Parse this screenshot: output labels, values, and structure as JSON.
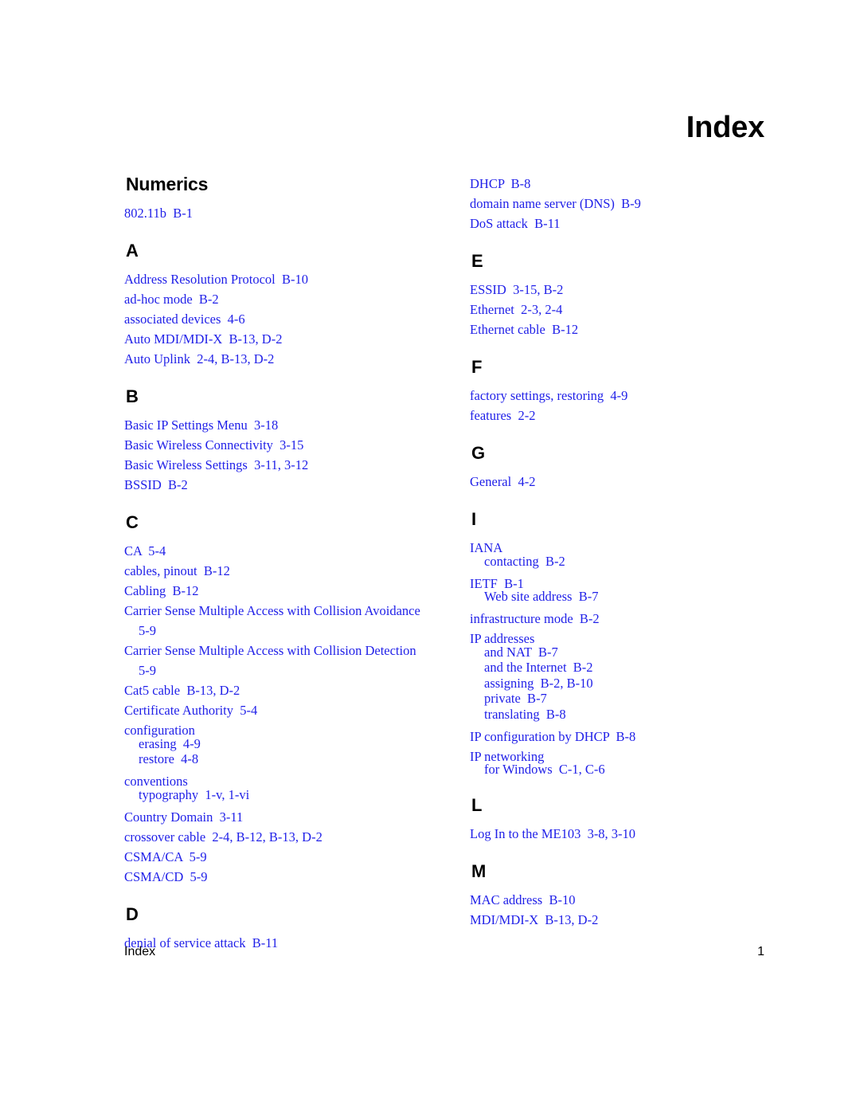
{
  "document": {
    "title": "Index",
    "text_color": "#1f1fe8",
    "heading_color": "#000000"
  },
  "footer": {
    "left_label": "Index",
    "page_number": "1"
  },
  "columns": [
    {
      "name": "left-column",
      "groups": [
        {
          "heading": "Numerics",
          "heading_kind": "word",
          "entries": [
            {
              "text": "802.11b  B-1",
              "level": 0
            }
          ]
        },
        {
          "heading": "A",
          "heading_kind": "letter",
          "entries": [
            {
              "text": "Address Resolution Protocol  B-10",
              "level": 0
            },
            {
              "text": "ad-hoc mode  B-2",
              "level": 0
            },
            {
              "text": "associated devices  4-6",
              "level": 0
            },
            {
              "text": "Auto MDI/MDI-X  B-13, D-2",
              "level": 0
            },
            {
              "text": "Auto Uplink  2-4, B-13, D-2",
              "level": 0
            }
          ]
        },
        {
          "heading": "B",
          "heading_kind": "letter",
          "entries": [
            {
              "text": "Basic IP Settings Menu  3-18",
              "level": 0
            },
            {
              "text": "Basic Wireless Connectivity  3-15",
              "level": 0
            },
            {
              "text": "Basic Wireless Settings  3-11, 3-12",
              "level": 0
            },
            {
              "text": "BSSID  B-2",
              "level": 0
            }
          ]
        },
        {
          "heading": "C",
          "heading_kind": "letter",
          "entries": [
            {
              "text": "CA  5-4",
              "level": 0
            },
            {
              "text": "cables, pinout  B-12",
              "level": 0
            },
            {
              "text": "Cabling  B-12",
              "level": 0
            },
            {
              "text": "Carrier Sense Multiple Access with Collision Avoidance  5-9",
              "level": 0
            },
            {
              "text": "Carrier Sense Multiple Access with Collision Detection  5-9",
              "level": 0
            },
            {
              "text": "Cat5 cable  B-13, D-2",
              "level": 0
            },
            {
              "text": "Certificate Authority  5-4",
              "level": 0
            },
            {
              "text": "configuration",
              "level": 0
            },
            {
              "text": "erasing  4-9",
              "level": 1
            },
            {
              "text": "restore  4-8",
              "level": 1
            },
            {
              "text": "conventions",
              "level": 0
            },
            {
              "text": "typography  1-v, 1-vi",
              "level": 1
            },
            {
              "text": "Country Domain  3-11",
              "level": 0
            },
            {
              "text": "crossover cable  2-4, B-12, B-13, D-2",
              "level": 0
            },
            {
              "text": "CSMA/CA  5-9",
              "level": 0
            },
            {
              "text": "CSMA/CD  5-9",
              "level": 0
            }
          ]
        },
        {
          "heading": "D",
          "heading_kind": "letter",
          "entries": [
            {
              "text": "denial of service attack  B-11",
              "level": 0
            }
          ]
        }
      ]
    },
    {
      "name": "right-column",
      "groups": [
        {
          "heading": "",
          "heading_kind": "none",
          "entries": [
            {
              "text": "DHCP  B-8",
              "level": 0
            },
            {
              "text": "domain name server (DNS)  B-9",
              "level": 0
            },
            {
              "text": "DoS attack  B-11",
              "level": 0
            }
          ]
        },
        {
          "heading": "E",
          "heading_kind": "letter",
          "entries": [
            {
              "text": "ESSID  3-15, B-2",
              "level": 0
            },
            {
              "text": "Ethernet  2-3, 2-4",
              "level": 0
            },
            {
              "text": "Ethernet cable  B-12",
              "level": 0
            }
          ]
        },
        {
          "heading": "F",
          "heading_kind": "letter",
          "entries": [
            {
              "text": "factory settings, restoring  4-9",
              "level": 0
            },
            {
              "text": "features  2-2",
              "level": 0
            }
          ]
        },
        {
          "heading": "G",
          "heading_kind": "letter",
          "entries": [
            {
              "text": "General  4-2",
              "level": 0
            }
          ]
        },
        {
          "heading": "I",
          "heading_kind": "letter",
          "entries": [
            {
              "text": "IANA",
              "level": 0
            },
            {
              "text": "contacting  B-2",
              "level": 1
            },
            {
              "text": "IETF  B-1",
              "level": 0
            },
            {
              "text": "Web site address  B-7",
              "level": 1
            },
            {
              "text": "infrastructure mode  B-2",
              "level": 0
            },
            {
              "text": "IP addresses",
              "level": 0
            },
            {
              "text": "and NAT  B-7",
              "level": 1
            },
            {
              "text": "and the Internet  B-2",
              "level": 1
            },
            {
              "text": "assigning  B-2, B-10",
              "level": 1
            },
            {
              "text": "private  B-7",
              "level": 1
            },
            {
              "text": "translating  B-8",
              "level": 1
            },
            {
              "text": "IP configuration by DHCP  B-8",
              "level": 0
            },
            {
              "text": "IP networking",
              "level": 0
            },
            {
              "text": "for Windows  C-1, C-6",
              "level": 1
            }
          ]
        },
        {
          "heading": "L",
          "heading_kind": "letter",
          "entries": [
            {
              "text": "Log In to the ME103  3-8, 3-10",
              "level": 0
            }
          ]
        },
        {
          "heading": "M",
          "heading_kind": "letter",
          "entries": [
            {
              "text": "MAC address  B-10",
              "level": 0
            },
            {
              "text": "MDI/MDI-X  B-13, D-2",
              "level": 0
            }
          ]
        }
      ]
    }
  ]
}
